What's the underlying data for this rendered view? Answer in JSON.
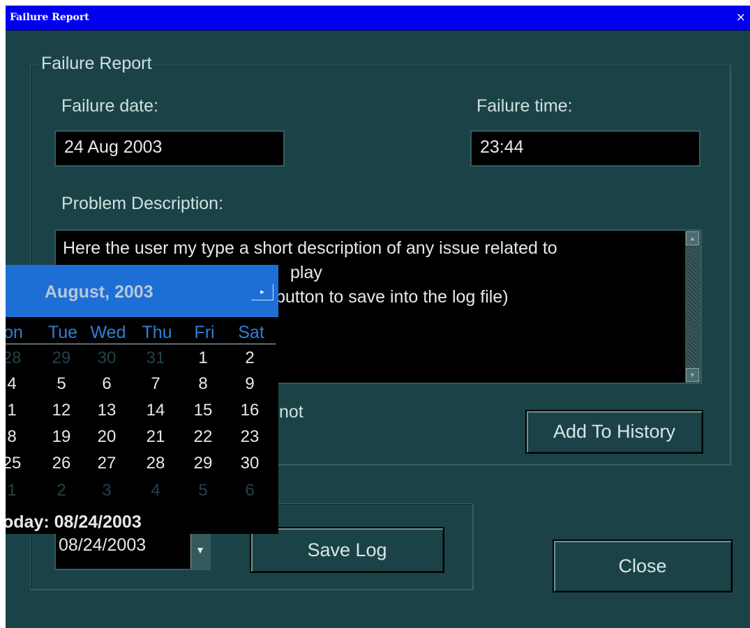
{
  "window": {
    "title": "Failure Report",
    "close_glyph": "×"
  },
  "form": {
    "group_title": "Failure Report",
    "date_label": "Failure date:",
    "date_value": "24 Aug 2003",
    "time_label": "Failure time:",
    "time_value": "23:44",
    "desc_label": "Problem Description:",
    "desc_text": "Here the user my type a short description of any issue related to\nplay\nbutton to save into the log file)",
    "partial_label": "not",
    "add_button": "Add To History"
  },
  "log": {
    "date_combo_value": "08/24/2003",
    "save_button": "Save Log",
    "close_button": "Close"
  },
  "calendar": {
    "month_label": "August, 2003",
    "next_glyph": "▸",
    "weekdays": [
      "on",
      "Tue",
      "Wed",
      "Thu",
      "Fri",
      "Sat"
    ],
    "weeks": [
      [
        "28",
        "29",
        "30",
        "31",
        "1",
        "2"
      ],
      [
        "4",
        "5",
        "6",
        "7",
        "8",
        "9"
      ],
      [
        "1",
        "12",
        "13",
        "14",
        "15",
        "16"
      ],
      [
        "8",
        "19",
        "20",
        "21",
        "22",
        "23"
      ],
      [
        "25",
        "26",
        "27",
        "28",
        "29",
        "30"
      ],
      [
        "1",
        "2",
        "3",
        "4",
        "5",
        "6"
      ]
    ],
    "today_label": "oday: 08/24/2003"
  }
}
